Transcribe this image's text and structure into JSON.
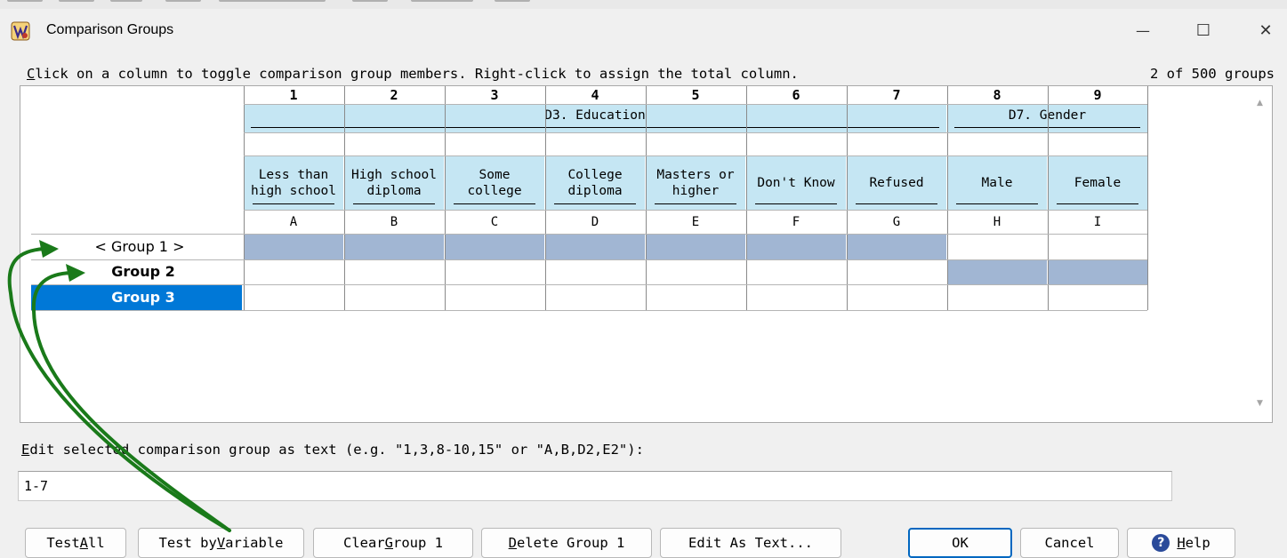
{
  "window": {
    "title": "Comparison Groups",
    "minimize_glyph": "—",
    "maximize_glyph": "☐",
    "close_glyph": "✕"
  },
  "instruction": {
    "lead": "C",
    "rest": "lick on a column to toggle comparison group members. Right-click to assign the total column."
  },
  "group_count": "2 of 500 groups",
  "grid": {
    "column_numbers": [
      "1",
      "2",
      "3",
      "4",
      "5",
      "6",
      "7",
      "8",
      "9"
    ],
    "banners": [
      {
        "label": "D3. Education",
        "span": [
          0,
          6
        ]
      },
      {
        "label": "D7. Gender",
        "span": [
          7,
          8
        ]
      }
    ],
    "column_labels": [
      [
        "Less than",
        "high school"
      ],
      [
        "High school",
        "diploma"
      ],
      [
        "Some",
        "college"
      ],
      [
        "College",
        "diploma"
      ],
      [
        "Masters or",
        "higher"
      ],
      [
        "Don't Know"
      ],
      [
        "Refused"
      ],
      [
        "Male"
      ],
      [
        "Female"
      ]
    ],
    "column_letters": [
      "A",
      "B",
      "C",
      "D",
      "E",
      "F",
      "G",
      "H",
      "I"
    ],
    "groups": [
      {
        "label": "< Group 1 >",
        "bold": false,
        "selected": false,
        "members": [
          true,
          true,
          true,
          true,
          true,
          true,
          true,
          false,
          false
        ]
      },
      {
        "label": "Group 2",
        "bold": true,
        "selected": false,
        "members": [
          false,
          false,
          false,
          false,
          false,
          false,
          false,
          true,
          true
        ]
      },
      {
        "label": "Group 3",
        "bold": true,
        "selected": true,
        "members": [
          false,
          false,
          false,
          false,
          false,
          false,
          false,
          false,
          false
        ]
      }
    ]
  },
  "edit_section": {
    "label_lead": "E",
    "label_rest": "dit selected comparison group as text (e.g. \"1,3,8-10,15\" or \"A,B,D2,E2\"):",
    "value": "1-7"
  },
  "buttons": {
    "test_all": {
      "pre": "Test ",
      "key": "A",
      "post": "ll"
    },
    "test_by_variable": {
      "pre": "Test by ",
      "key": "V",
      "post": "ariable"
    },
    "clear_group": {
      "pre": "Clear ",
      "key": "G",
      "post": "roup 1"
    },
    "delete_group": {
      "pre": "",
      "key": "D",
      "post": "elete Group 1"
    },
    "edit_as_text": {
      "label": "Edit As Text..."
    },
    "ok": {
      "label": "OK"
    },
    "cancel": {
      "label": "Cancel"
    },
    "help": {
      "pre": "",
      "key": "H",
      "post": "elp",
      "icon_glyph": "?"
    }
  },
  "colors": {
    "member_fill": "#a1b6d3",
    "header_fill": "#c5e6f3",
    "selected_row": "#0078d7",
    "annotation_arrow": "#1a7a1a"
  }
}
